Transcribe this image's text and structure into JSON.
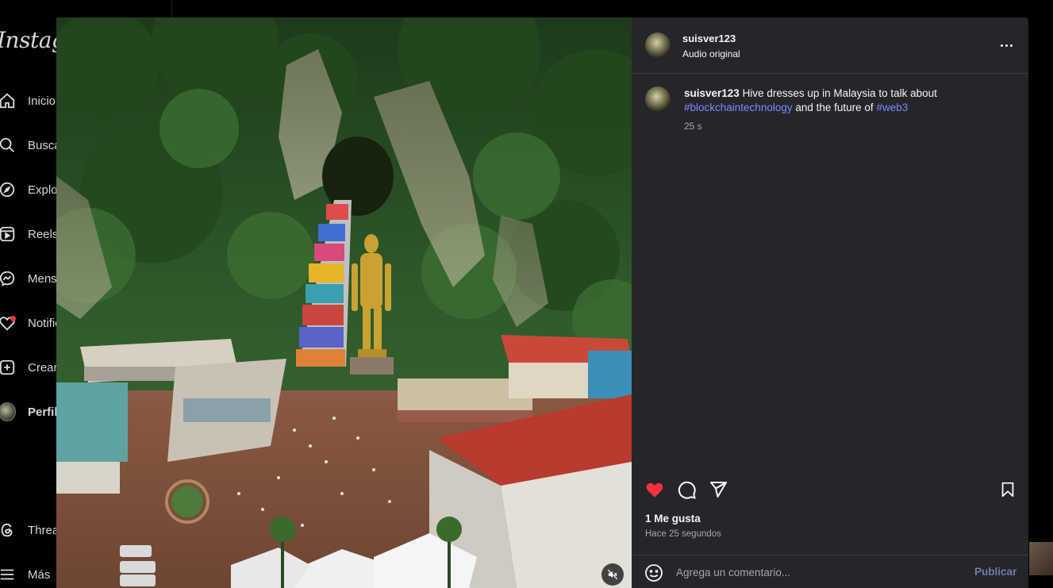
{
  "sidebar": {
    "logo": "Instagram",
    "items": [
      {
        "label": "Inicio",
        "icon": "home-icon"
      },
      {
        "label": "Buscar",
        "icon": "search-icon"
      },
      {
        "label": "Explorar",
        "icon": "explore-icon"
      },
      {
        "label": "Reels",
        "icon": "reels-icon"
      },
      {
        "label": "Mensajes",
        "icon": "messenger-icon"
      },
      {
        "label": "Notificaciones",
        "icon": "heart-icon"
      },
      {
        "label": "Crear",
        "icon": "create-icon"
      },
      {
        "label": "Perfil",
        "icon": "avatar"
      },
      {
        "label": "Threads",
        "icon": "threads-icon"
      },
      {
        "label": "Más",
        "icon": "menu-icon"
      }
    ]
  },
  "post": {
    "header": {
      "username": "suisver123",
      "audio": "Audio original"
    },
    "caption": {
      "username": "suisver123",
      "text_before": " Hive dresses up in Malaysia to talk about ",
      "hashtag1": "#blockchaintechnology",
      "text_middle": " and the future of ",
      "hashtag2": "#web3",
      "time": "25 s"
    },
    "likes": "1 Me gusta",
    "posted": "Hace 25 segundos",
    "comment": {
      "placeholder": "Agrega un comentario...",
      "publish_label": "Publicar"
    }
  },
  "colors": {
    "panel_bg": "#25252a",
    "like_red": "#ff3040",
    "hashtag": "#7b8cff",
    "publish": "#6f7fa3"
  }
}
